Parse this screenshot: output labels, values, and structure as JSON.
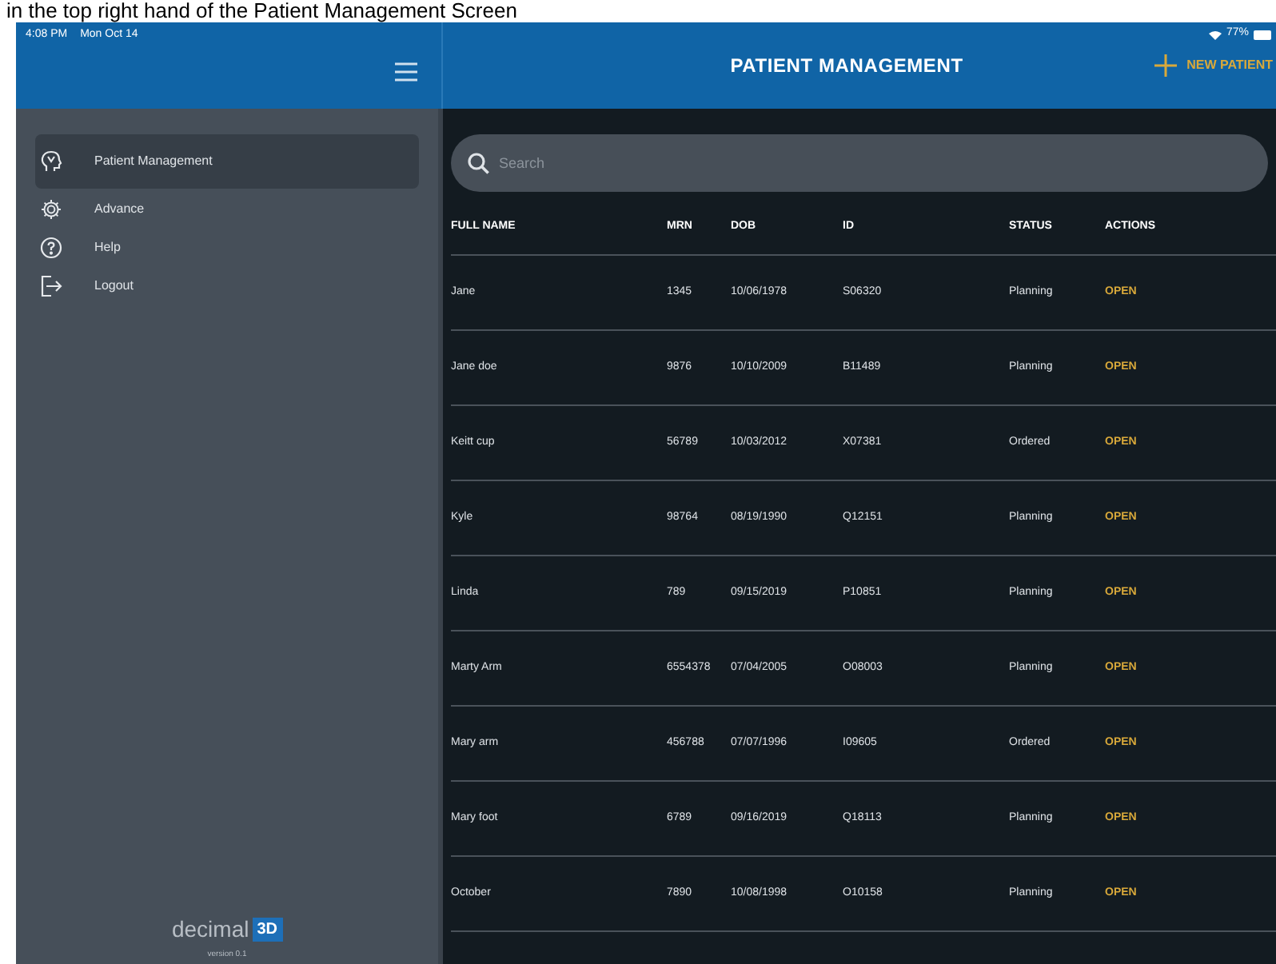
{
  "caption": "in the top right hand of the Patient Management Screen",
  "status_bar": {
    "time": "4:08 PM",
    "date": "Mon Oct 14",
    "battery": "77%"
  },
  "header": {
    "title": "PATIENT MANAGEMENT",
    "action": "NEW PATIENT"
  },
  "sidebar": {
    "items": [
      {
        "label": "Patient Management",
        "selected": true
      },
      {
        "label": "Advance",
        "selected": false
      },
      {
        "label": "Help",
        "selected": false
      },
      {
        "label": "Logout",
        "selected": false
      }
    ],
    "logo": {
      "text": "decimal",
      "badge": "3D"
    },
    "version": "version 0.1"
  },
  "search": {
    "placeholder": "Search"
  },
  "table": {
    "columns": [
      "FULL NAME",
      "MRN",
      "DOB",
      "ID",
      "STATUS",
      "ACTIONS"
    ],
    "rows": [
      [
        "Jane",
        "1345",
        "10/06/1978",
        "S06320",
        "Planning",
        "OPEN"
      ],
      [
        "Jane doe",
        "9876",
        "10/10/2009",
        "B11489",
        "Planning",
        "OPEN"
      ],
      [
        "Keitt cup",
        "56789",
        "10/03/2012",
        "X07381",
        "Ordered",
        "OPEN"
      ],
      [
        "Kyle",
        "98764",
        "08/19/1990",
        "Q12151",
        "Planning",
        "OPEN"
      ],
      [
        "Linda",
        "789",
        "09/15/2019",
        "P10851",
        "Planning",
        "OPEN"
      ],
      [
        "Marty Arm",
        "6554378",
        "07/04/2005",
        "O08003",
        "Planning",
        "OPEN"
      ],
      [
        "Mary arm",
        "456788",
        "07/07/1996",
        "I09605",
        "Ordered",
        "OPEN"
      ],
      [
        "Mary foot",
        "6789",
        "09/16/2019",
        "Q18113",
        "Planning",
        "OPEN"
      ],
      [
        "October",
        "7890",
        "10/08/1998",
        "O10158",
        "Planning",
        "OPEN"
      ]
    ]
  }
}
